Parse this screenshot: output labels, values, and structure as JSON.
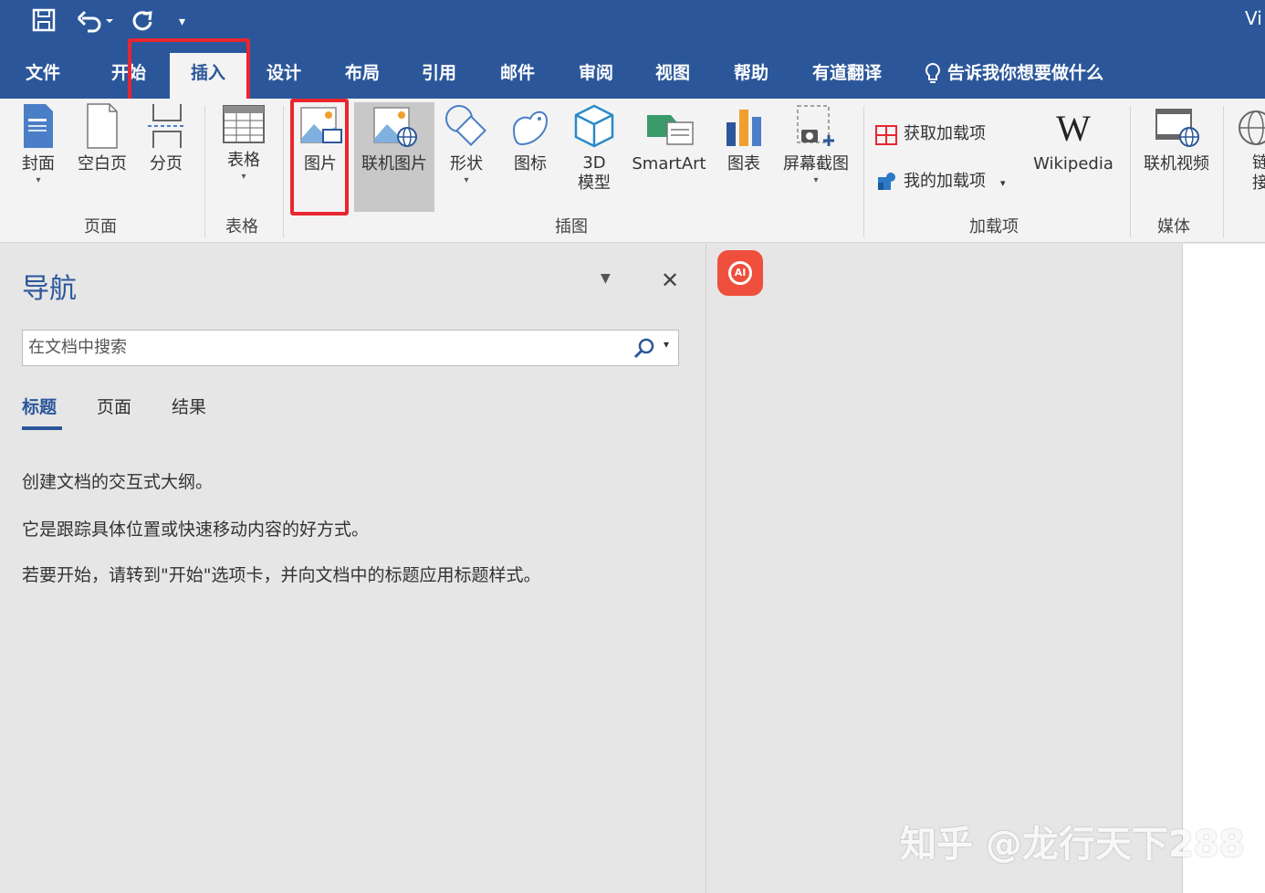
{
  "quick_access": {
    "save_icon": "save-icon",
    "undo_icon": "undo-icon",
    "redo_icon": "redo-icon",
    "customize_icon": "customize-qat-icon"
  },
  "title_truncated": "Vi",
  "tabs": [
    "文件",
    "开始",
    "插入",
    "设计",
    "布局",
    "引用",
    "邮件",
    "审阅",
    "视图",
    "帮助",
    "有道翻译"
  ],
  "active_tab": "插入",
  "tell_me": "告诉我你想要做什么",
  "ribbon": {
    "pages": {
      "group": "页面",
      "cover": "封面",
      "blank": "空白页",
      "break": "分页"
    },
    "tables": {
      "group": "表格",
      "table": "表格"
    },
    "illustrations": {
      "group": "插图",
      "picture": "图片",
      "online_picture": "联机图片",
      "shapes": "形状",
      "icons": "图标",
      "model_3d_line1": "3D",
      "model_3d_line2": "模型",
      "smartart": "SmartArt",
      "chart": "图表",
      "screenshot": "屏幕截图"
    },
    "addins": {
      "group": "加载项",
      "get": "获取加载项",
      "my": "我的加载项",
      "wikipedia": "Wikipedia"
    },
    "media": {
      "group": "媒体",
      "online_video": "联机视频"
    },
    "cut_off_1": "链",
    "cut_off_2": "接"
  },
  "nav": {
    "title": "导航",
    "search_placeholder": "在文档中搜索",
    "tabs": [
      "标题",
      "页面",
      "结果"
    ],
    "lines": [
      "创建文档的交互式大纲。",
      "它是跟踪具体位置或快速移动内容的好方式。",
      "若要开始，请转到\"开始\"选项卡，并向文档中的标题应用标题样式。"
    ]
  },
  "ai_badge": "AI",
  "watermark": "知乎 @龙行天下288",
  "colors": {
    "brand_blue": "#2b579a",
    "highlight_red": "#e8262f",
    "ai_orange": "#ef4f3c"
  }
}
